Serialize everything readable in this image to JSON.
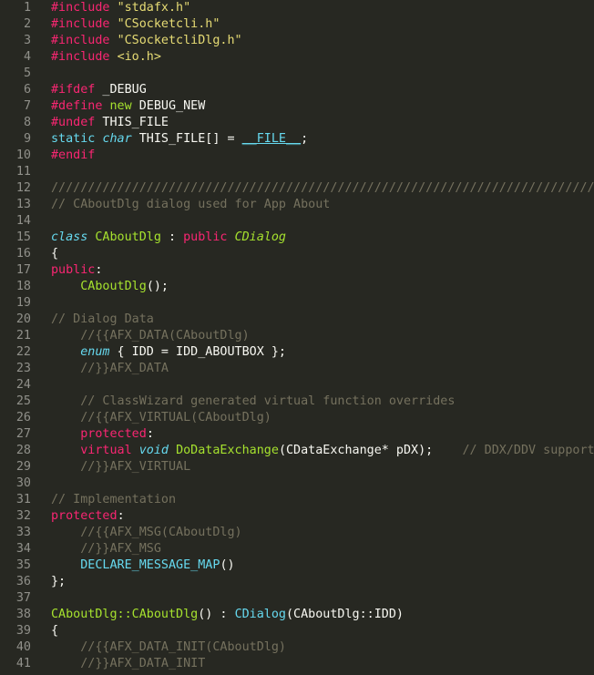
{
  "editor": {
    "theme": {
      "background": "#272822",
      "foreground": "#f8f8f2",
      "gutter": "#90908a",
      "keyword": "#f92672",
      "string": "#e6db74",
      "comment": "#75715e",
      "type": "#66d9ef",
      "function": "#a6e22e"
    },
    "lines": [
      {
        "n": "1",
        "tokens": [
          [
            "pp",
            "#include"
          ],
          [
            "text",
            " "
          ],
          [
            "str",
            "\"stdafx.h\""
          ]
        ]
      },
      {
        "n": "2",
        "tokens": [
          [
            "pp",
            "#include"
          ],
          [
            "text",
            " "
          ],
          [
            "str",
            "\"CSocketcli.h\""
          ]
        ]
      },
      {
        "n": "3",
        "tokens": [
          [
            "pp",
            "#include"
          ],
          [
            "text",
            " "
          ],
          [
            "str",
            "\"CSocketcliDlg.h\""
          ]
        ]
      },
      {
        "n": "4",
        "tokens": [
          [
            "pp",
            "#include"
          ],
          [
            "text",
            " "
          ],
          [
            "str",
            "<io.h>"
          ]
        ]
      },
      {
        "n": "5",
        "tokens": []
      },
      {
        "n": "6",
        "tokens": [
          [
            "pp",
            "#ifdef"
          ],
          [
            "text",
            " _DEBUG"
          ]
        ]
      },
      {
        "n": "7",
        "tokens": [
          [
            "pp",
            "#define"
          ],
          [
            "text",
            " "
          ],
          [
            "class",
            "new"
          ],
          [
            "text",
            " DEBUG_NEW"
          ]
        ]
      },
      {
        "n": "8",
        "tokens": [
          [
            "pp",
            "#undef"
          ],
          [
            "text",
            " THIS_FILE"
          ]
        ]
      },
      {
        "n": "9",
        "tokens": [
          [
            "builtin",
            "static"
          ],
          [
            "text",
            " "
          ],
          [
            "type",
            "char"
          ],
          [
            "text",
            " THIS_FILE[] = "
          ],
          [
            "macro",
            "__FILE__"
          ],
          [
            "text",
            ";"
          ]
        ]
      },
      {
        "n": "10",
        "tokens": [
          [
            "pp",
            "#endif"
          ]
        ]
      },
      {
        "n": "11",
        "tokens": []
      },
      {
        "n": "12",
        "tokens": [
          [
            "comment",
            "//////////////////////////////////////////////////////////////////////////////"
          ]
        ]
      },
      {
        "n": "13",
        "tokens": [
          [
            "comment",
            "// CAboutDlg dialog used for App About"
          ]
        ]
      },
      {
        "n": "14",
        "tokens": []
      },
      {
        "n": "15",
        "tokens": [
          [
            "type",
            "class"
          ],
          [
            "text",
            " "
          ],
          [
            "class",
            "CAboutDlg"
          ],
          [
            "text",
            " : "
          ],
          [
            "kw",
            "public"
          ],
          [
            "text",
            " "
          ],
          [
            "inherit",
            "CDialog"
          ]
        ]
      },
      {
        "n": "16",
        "tokens": [
          [
            "text",
            "{"
          ]
        ]
      },
      {
        "n": "17",
        "tokens": [
          [
            "kw",
            "public"
          ],
          [
            "text",
            ":"
          ]
        ]
      },
      {
        "n": "18",
        "tokens": [
          [
            "text",
            "    "
          ],
          [
            "func",
            "CAboutDlg"
          ],
          [
            "text",
            "();"
          ]
        ]
      },
      {
        "n": "19",
        "tokens": []
      },
      {
        "n": "20",
        "tokens": [
          [
            "comment",
            "// Dialog Data"
          ]
        ]
      },
      {
        "n": "21",
        "tokens": [
          [
            "text",
            "    "
          ],
          [
            "comment",
            "//{{AFX_DATA(CAboutDlg)"
          ]
        ]
      },
      {
        "n": "22",
        "tokens": [
          [
            "text",
            "    "
          ],
          [
            "type",
            "enum"
          ],
          [
            "text",
            " { IDD = IDD_ABOUTBOX };"
          ]
        ]
      },
      {
        "n": "23",
        "tokens": [
          [
            "text",
            "    "
          ],
          [
            "comment",
            "//}}AFX_DATA"
          ]
        ]
      },
      {
        "n": "24",
        "tokens": []
      },
      {
        "n": "25",
        "tokens": [
          [
            "text",
            "    "
          ],
          [
            "comment",
            "// ClassWizard generated virtual function overrides"
          ]
        ]
      },
      {
        "n": "26",
        "tokens": [
          [
            "text",
            "    "
          ],
          [
            "comment",
            "//{{AFX_VIRTUAL(CAboutDlg)"
          ]
        ]
      },
      {
        "n": "27",
        "tokens": [
          [
            "text",
            "    "
          ],
          [
            "kw",
            "protected"
          ],
          [
            "text",
            ":"
          ]
        ]
      },
      {
        "n": "28",
        "tokens": [
          [
            "text",
            "    "
          ],
          [
            "kw",
            "virtual"
          ],
          [
            "text",
            " "
          ],
          [
            "type",
            "void"
          ],
          [
            "text",
            " "
          ],
          [
            "func",
            "DoDataExchange"
          ],
          [
            "text",
            "(CDataExchange* pDX);    "
          ],
          [
            "comment",
            "// DDX/DDV support"
          ]
        ]
      },
      {
        "n": "29",
        "tokens": [
          [
            "text",
            "    "
          ],
          [
            "comment",
            "//}}AFX_VIRTUAL"
          ]
        ]
      },
      {
        "n": "30",
        "tokens": []
      },
      {
        "n": "31",
        "tokens": [
          [
            "comment",
            "// Implementation"
          ]
        ]
      },
      {
        "n": "32",
        "tokens": [
          [
            "kw",
            "protected"
          ],
          [
            "text",
            ":"
          ]
        ]
      },
      {
        "n": "33",
        "tokens": [
          [
            "text",
            "    "
          ],
          [
            "comment",
            "//{{AFX_MSG(CAboutDlg)"
          ]
        ]
      },
      {
        "n": "34",
        "tokens": [
          [
            "text",
            "    "
          ],
          [
            "comment",
            "//}}AFX_MSG"
          ]
        ]
      },
      {
        "n": "35",
        "tokens": [
          [
            "text",
            "    "
          ],
          [
            "builtin",
            "DECLARE_MESSAGE_MAP"
          ],
          [
            "text",
            "()"
          ]
        ]
      },
      {
        "n": "36",
        "tokens": [
          [
            "text",
            "};"
          ]
        ]
      },
      {
        "n": "37",
        "tokens": []
      },
      {
        "n": "38",
        "tokens": [
          [
            "func",
            "CAboutDlg::CAboutDlg"
          ],
          [
            "text",
            "() : "
          ],
          [
            "builtin",
            "CDialog"
          ],
          [
            "text",
            "(CAboutDlg::IDD)"
          ]
        ]
      },
      {
        "n": "39",
        "tokens": [
          [
            "text",
            "{"
          ]
        ]
      },
      {
        "n": "40",
        "tokens": [
          [
            "text",
            "    "
          ],
          [
            "comment",
            "//{{AFX_DATA_INIT(CAboutDlg)"
          ]
        ]
      },
      {
        "n": "41",
        "tokens": [
          [
            "text",
            "    "
          ],
          [
            "comment",
            "//}}AFX_DATA_INIT"
          ]
        ]
      }
    ]
  }
}
